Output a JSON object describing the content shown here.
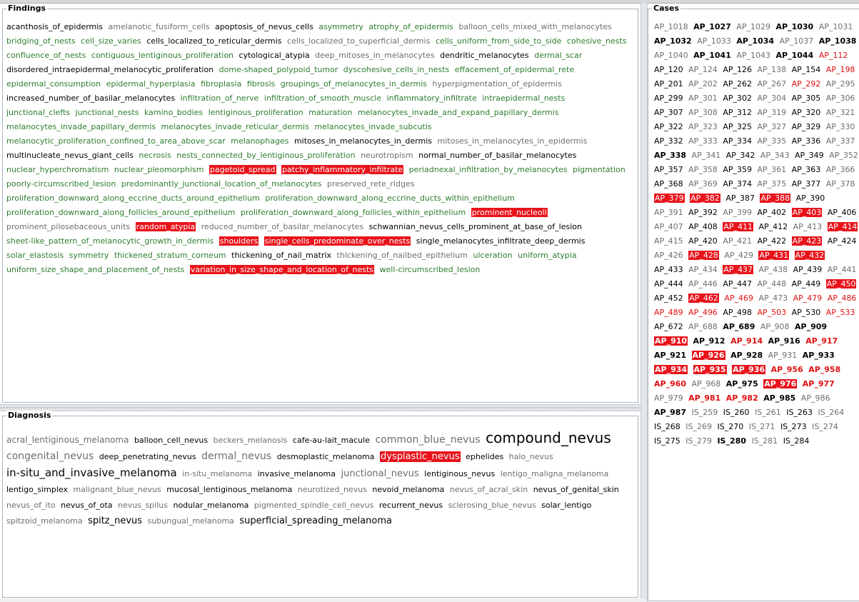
{
  "panels": {
    "findings_title": "Findings",
    "diagnosis_title": "Diagnosis",
    "cases_title": "Cases"
  },
  "colors": {
    "positive": "#2e7d2e",
    "negative": "#000000",
    "inactive": "#6e6e6e",
    "alert": "#e01010",
    "selected_bg": "#e8131b"
  },
  "findings": [
    {
      "t": "acanthosis_of_epidermis",
      "s": "neutral"
    },
    {
      "t": "amelanotic_fusiform_cells",
      "s": "gray"
    },
    {
      "t": "apoptosis_of_nevus_cells",
      "s": "neutral"
    },
    {
      "t": "asymmetry",
      "s": "green"
    },
    {
      "t": "atrophy_of_epidermis",
      "s": "green"
    },
    {
      "t": "balloon_cells_mixed_with_melanocytes",
      "s": "gray"
    },
    {
      "t": "bridging_of_nests",
      "s": "green"
    },
    {
      "t": "cell_size_varies",
      "s": "green"
    },
    {
      "t": "cells_localized_to_reticular_dermis",
      "s": "neutral"
    },
    {
      "t": "cells_localized_to_superficial_dermis",
      "s": "gray"
    },
    {
      "t": "cells_uniform_from_side_to_side",
      "s": "green"
    },
    {
      "t": "cohesive_nests",
      "s": "green"
    },
    {
      "t": "confluence_of_nests",
      "s": "green"
    },
    {
      "t": "contiguous_lentiginous_proliferation",
      "s": "green"
    },
    {
      "t": "cytological_atypia",
      "s": "neutral"
    },
    {
      "t": "deep_mitoses_in_melanocytes",
      "s": "gray"
    },
    {
      "t": "dendritic_melanocytes",
      "s": "neutral"
    },
    {
      "t": "dermal_scar",
      "s": "green"
    },
    {
      "t": "disordered_intraepidermal_melanocytic_proliferation",
      "s": "neutral"
    },
    {
      "t": "dome-shaped_polypoid_tumor",
      "s": "green"
    },
    {
      "t": "dyscohesive_cells_in_nests",
      "s": "green"
    },
    {
      "t": "effacement_of_epidermal_rete",
      "s": "green"
    },
    {
      "t": "epidermal_consumption",
      "s": "green"
    },
    {
      "t": "epidermal_hyperplasia",
      "s": "green"
    },
    {
      "t": "fibroplasia",
      "s": "green"
    },
    {
      "t": "fibrosis",
      "s": "green"
    },
    {
      "t": "groupings_of_melanocytes_in_dermis",
      "s": "green"
    },
    {
      "t": "hyperpigmentation_of_epidermis",
      "s": "gray"
    },
    {
      "t": "increased_number_of_basilar_melanocytes",
      "s": "neutral"
    },
    {
      "t": "infiltration_of_nerve",
      "s": "green"
    },
    {
      "t": "infiltration_of_smooth_muscle",
      "s": "green"
    },
    {
      "t": "inflammatory_infiltrate",
      "s": "green"
    },
    {
      "t": "intraepidermal_nests",
      "s": "green"
    },
    {
      "t": "junctional_clefts",
      "s": "green"
    },
    {
      "t": "junctional_nests",
      "s": "green"
    },
    {
      "t": "kamino_bodies",
      "s": "green"
    },
    {
      "t": "lentiginous_proliferation",
      "s": "green"
    },
    {
      "t": "maturation",
      "s": "green"
    },
    {
      "t": "melanocytes_invade_and_expand_papillary_dermis",
      "s": "green"
    },
    {
      "t": "melanocytes_invade_papillary_dermis",
      "s": "green"
    },
    {
      "t": "melanocytes_invade_reticular_dermis",
      "s": "green"
    },
    {
      "t": "melanocytes_invade_subcutis",
      "s": "green"
    },
    {
      "t": "melanocytic_proliferation_confined_to_area_above_scar",
      "s": "green"
    },
    {
      "t": "melanophages",
      "s": "green"
    },
    {
      "t": "mitoses_in_melanocytes_in_dermis",
      "s": "neutral"
    },
    {
      "t": "mitoses_in_melanocytes_in_epidermis",
      "s": "gray"
    },
    {
      "t": "multinucleate_nevus_giant_cells",
      "s": "neutral"
    },
    {
      "t": "necrosis",
      "s": "green"
    },
    {
      "t": "nests_connected_by_lentiginous_proliferation",
      "s": "green"
    },
    {
      "t": "neurotropism",
      "s": "gray"
    },
    {
      "t": "normal_number_of_basilar_melanocytes",
      "s": "neutral"
    },
    {
      "t": "nuclear_hyperchromatism",
      "s": "green"
    },
    {
      "t": "nuclear_pleomorphism",
      "s": "green"
    },
    {
      "t": "pagetoid_spread",
      "s": "sel"
    },
    {
      "t": "patchy_inflammatory_infiltrate",
      "s": "sel"
    },
    {
      "t": "periadnexal_infiltration_by_melanocytes",
      "s": "green"
    },
    {
      "t": "pigmentation",
      "s": "green"
    },
    {
      "t": "poorly-circumscribed_lesion",
      "s": "green"
    },
    {
      "t": "predominantly_junctional_location_of_melanocytes",
      "s": "green"
    },
    {
      "t": "preserved_rete_ridges",
      "s": "gray"
    },
    {
      "t": "proliferation_downward_along_eccrine_ducts_around_epithelium",
      "s": "green"
    },
    {
      "t": "proliferation_downward_along_eccrine_ducts_within_epithelium",
      "s": "green"
    },
    {
      "t": "proliferation_downward_along_follicles_around_epithelium",
      "s": "green"
    },
    {
      "t": "proliferation_downward_along_follicles_within_epithelium",
      "s": "green"
    },
    {
      "t": "prominent_nucleoli",
      "s": "sel"
    },
    {
      "t": "prominent_pilosebaceous_units",
      "s": "gray"
    },
    {
      "t": "random_atypia",
      "s": "sel"
    },
    {
      "t": "reduced_number_of_basilar_melanocytes",
      "s": "gray"
    },
    {
      "t": "schwannian_nevus_cells_prominent_at_base_of_lesion",
      "s": "neutral"
    },
    {
      "t": "sheet-like_pattern_of_melanocytic_growth_in_dermis",
      "s": "green"
    },
    {
      "t": "shoulders",
      "s": "sel"
    },
    {
      "t": "single_cells_predominate_over_nests",
      "s": "sel"
    },
    {
      "t": "single_melanocytes_infiltrate_deep_dermis",
      "s": "neutral"
    },
    {
      "t": "solar_elastosis",
      "s": "green"
    },
    {
      "t": "symmetry",
      "s": "green"
    },
    {
      "t": "thickened_stratum_corneum",
      "s": "green"
    },
    {
      "t": "thickening_of_nail_matrix",
      "s": "neutral"
    },
    {
      "t": "thickening_of_nailbed_epithelium",
      "s": "gray"
    },
    {
      "t": "ulceration",
      "s": "green"
    },
    {
      "t": "uniform_atypia",
      "s": "green"
    },
    {
      "t": "uniform_size_shape_and_placement_of_nests",
      "s": "green"
    },
    {
      "t": "variation_in_size_shape_and_location_of_nests",
      "s": "sel"
    },
    {
      "t": "well-circumscribed_lesion",
      "s": "green"
    }
  ],
  "diagnosis": [
    {
      "t": "acral_lentiginous_melanoma",
      "s": "gray",
      "z": 12
    },
    {
      "t": "balloon_cell_nevus",
      "s": "neutral",
      "z": 11
    },
    {
      "t": "beckers_melanosis",
      "s": "gray",
      "z": 11
    },
    {
      "t": "cafe-au-lait_macule",
      "s": "neutral",
      "z": 11
    },
    {
      "t": "common_blue_nevus",
      "s": "gray",
      "z": 14
    },
    {
      "t": "compound_nevus",
      "s": "neutral",
      "z": 20
    },
    {
      "t": "congenital_nevus",
      "s": "gray",
      "z": 14
    },
    {
      "t": "deep_penetrating_nevus",
      "s": "neutral",
      "z": 11
    },
    {
      "t": "dermal_nevus",
      "s": "gray",
      "z": 14
    },
    {
      "t": "desmoplastic_melanoma",
      "s": "neutral",
      "z": 11
    },
    {
      "t": "dysplastic_nevus",
      "s": "sel",
      "z": 13
    },
    {
      "t": "ephelides",
      "s": "neutral",
      "z": 11
    },
    {
      "t": "halo_nevus",
      "s": "gray",
      "z": 11
    },
    {
      "t": "in-situ_and_invasive_melanoma",
      "s": "neutral",
      "z": 15
    },
    {
      "t": "in-situ_melanoma",
      "s": "gray",
      "z": 11
    },
    {
      "t": "invasive_melanoma",
      "s": "neutral",
      "z": 11
    },
    {
      "t": "junctional_nevus",
      "s": "gray",
      "z": 13
    },
    {
      "t": "lentiginous_nevus",
      "s": "neutral",
      "z": 11
    },
    {
      "t": "lentigo_maligna_melanoma",
      "s": "gray",
      "z": 11
    },
    {
      "t": "lentigo_simplex",
      "s": "neutral",
      "z": 11
    },
    {
      "t": "malignant_blue_nevus",
      "s": "gray",
      "z": 11
    },
    {
      "t": "mucosal_lentiginous_melanoma",
      "s": "neutral",
      "z": 11
    },
    {
      "t": "neurotized_nevus",
      "s": "gray",
      "z": 11
    },
    {
      "t": "nevoid_melanoma",
      "s": "neutral",
      "z": 11
    },
    {
      "t": "nevus_of_acral_skin",
      "s": "gray",
      "z": 11
    },
    {
      "t": "nevus_of_genital_skin",
      "s": "neutral",
      "z": 11
    },
    {
      "t": "nevus_of_ito",
      "s": "gray",
      "z": 11
    },
    {
      "t": "nevus_of_ota",
      "s": "neutral",
      "z": 11
    },
    {
      "t": "nevus_spilus",
      "s": "gray",
      "z": 11
    },
    {
      "t": "nodular_melanoma",
      "s": "neutral",
      "z": 11
    },
    {
      "t": "pigmented_spindle_cell_nevus",
      "s": "gray",
      "z": 11
    },
    {
      "t": "recurrent_nevus",
      "s": "neutral",
      "z": 11
    },
    {
      "t": "sclerosing_blue_nevus",
      "s": "gray",
      "z": 11
    },
    {
      "t": "solar_lentigo",
      "s": "neutral",
      "z": 11
    },
    {
      "t": "spitzoid_melanoma",
      "s": "gray",
      "z": 11
    },
    {
      "t": "spitz_nevus",
      "s": "neutral",
      "z": 13
    },
    {
      "t": "subungual_melanoma",
      "s": "gray",
      "z": 11
    },
    {
      "t": "superficial_spreading_melanoma",
      "s": "neutral",
      "z": 13
    }
  ],
  "cases": [
    {
      "t": "AP_1018",
      "s": "gray"
    },
    {
      "t": "AP_1027",
      "s": "bold"
    },
    {
      "t": "AP_1029",
      "s": "gray"
    },
    {
      "t": "AP_1030",
      "s": "bold"
    },
    {
      "t": "AP_1031",
      "s": "gray"
    },
    {
      "t": "AP_1032",
      "s": "bold"
    },
    {
      "t": "AP_1033",
      "s": "gray"
    },
    {
      "t": "AP_1034",
      "s": "bold"
    },
    {
      "t": "AP_1037",
      "s": "gray"
    },
    {
      "t": "AP_1038",
      "s": "bold"
    },
    {
      "t": "AP_1040",
      "s": "gray"
    },
    {
      "t": "AP_1041",
      "s": "bold"
    },
    {
      "t": "AP_1043",
      "s": "gray"
    },
    {
      "t": "AP_1044",
      "s": "bold"
    },
    {
      "t": "AP_112",
      "s": "red"
    },
    {
      "t": "AP_120",
      "s": "neutral"
    },
    {
      "t": "AP_124",
      "s": "gray"
    },
    {
      "t": "AP_126",
      "s": "neutral"
    },
    {
      "t": "AP_138",
      "s": "gray"
    },
    {
      "t": "AP_154",
      "s": "neutral"
    },
    {
      "t": "AP_198",
      "s": "red"
    },
    {
      "t": "AP_201",
      "s": "neutral"
    },
    {
      "t": "AP_202",
      "s": "gray"
    },
    {
      "t": "AP_262",
      "s": "neutral"
    },
    {
      "t": "AP_267",
      "s": "gray"
    },
    {
      "t": "AP_292",
      "s": "red"
    },
    {
      "t": "AP_295",
      "s": "gray"
    },
    {
      "t": "AP_299",
      "s": "neutral"
    },
    {
      "t": "AP_301",
      "s": "gray"
    },
    {
      "t": "AP_302",
      "s": "neutral"
    },
    {
      "t": "AP_304",
      "s": "gray"
    },
    {
      "t": "AP_305",
      "s": "neutral"
    },
    {
      "t": "AP_306",
      "s": "gray"
    },
    {
      "t": "AP_307",
      "s": "neutral"
    },
    {
      "t": "AP_308",
      "s": "gray"
    },
    {
      "t": "AP_312",
      "s": "neutral"
    },
    {
      "t": "AP_319",
      "s": "gray"
    },
    {
      "t": "AP_320",
      "s": "neutral"
    },
    {
      "t": "AP_321",
      "s": "gray"
    },
    {
      "t": "AP_322",
      "s": "neutral"
    },
    {
      "t": "AP_323",
      "s": "gray"
    },
    {
      "t": "AP_325",
      "s": "neutral"
    },
    {
      "t": "AP_327",
      "s": "gray"
    },
    {
      "t": "AP_329",
      "s": "neutral"
    },
    {
      "t": "AP_330",
      "s": "gray"
    },
    {
      "t": "AP_332",
      "s": "neutral"
    },
    {
      "t": "AP_333",
      "s": "gray"
    },
    {
      "t": "AP_334",
      "s": "neutral"
    },
    {
      "t": "AP_335",
      "s": "gray"
    },
    {
      "t": "AP_336",
      "s": "neutral"
    },
    {
      "t": "AP_337",
      "s": "gray"
    },
    {
      "t": "AP_338",
      "s": "bold"
    },
    {
      "t": "AP_341",
      "s": "gray"
    },
    {
      "t": "AP_342",
      "s": "neutral"
    },
    {
      "t": "AP_343",
      "s": "gray"
    },
    {
      "t": "AP_349",
      "s": "neutral"
    },
    {
      "t": "AP_352",
      "s": "gray"
    },
    {
      "t": "AP_357",
      "s": "neutral"
    },
    {
      "t": "AP_358",
      "s": "gray"
    },
    {
      "t": "AP_359",
      "s": "neutral"
    },
    {
      "t": "AP_361",
      "s": "gray"
    },
    {
      "t": "AP_363",
      "s": "neutral"
    },
    {
      "t": "AP_366",
      "s": "gray"
    },
    {
      "t": "AP_368",
      "s": "neutral"
    },
    {
      "t": "AP_369",
      "s": "gray"
    },
    {
      "t": "AP_374",
      "s": "neutral"
    },
    {
      "t": "AP_375",
      "s": "gray"
    },
    {
      "t": "AP_377",
      "s": "neutral"
    },
    {
      "t": "AP_378",
      "s": "gray"
    },
    {
      "t": "AP_379",
      "s": "sel"
    },
    {
      "t": "AP_382",
      "s": "sel"
    },
    {
      "t": "AP_387",
      "s": "neutral"
    },
    {
      "t": "AP_388",
      "s": "sel"
    },
    {
      "t": "AP_390",
      "s": "neutral"
    },
    {
      "t": "AP_391",
      "s": "gray"
    },
    {
      "t": "AP_392",
      "s": "neutral"
    },
    {
      "t": "AP_399",
      "s": "gray"
    },
    {
      "t": "AP_402",
      "s": "neutral"
    },
    {
      "t": "AP_403",
      "s": "sel"
    },
    {
      "t": "AP_406",
      "s": "neutral"
    },
    {
      "t": "AP_407",
      "s": "gray"
    },
    {
      "t": "AP_408",
      "s": "neutral"
    },
    {
      "t": "AP_411",
      "s": "sel"
    },
    {
      "t": "AP_412",
      "s": "neutral"
    },
    {
      "t": "AP_413",
      "s": "gray"
    },
    {
      "t": "AP_414",
      "s": "sel"
    },
    {
      "t": "AP_415",
      "s": "gray"
    },
    {
      "t": "AP_420",
      "s": "neutral"
    },
    {
      "t": "AP_421",
      "s": "gray"
    },
    {
      "t": "AP_422",
      "s": "neutral"
    },
    {
      "t": "AP_423",
      "s": "sel"
    },
    {
      "t": "AP_424",
      "s": "neutral"
    },
    {
      "t": "AP_426",
      "s": "gray"
    },
    {
      "t": "AP_428",
      "s": "sel"
    },
    {
      "t": "AP_429",
      "s": "gray"
    },
    {
      "t": "AP_431",
      "s": "sel"
    },
    {
      "t": "AP_432",
      "s": "sel"
    },
    {
      "t": "AP_433",
      "s": "neutral"
    },
    {
      "t": "AP_434",
      "s": "gray"
    },
    {
      "t": "AP_437",
      "s": "sel"
    },
    {
      "t": "AP_438",
      "s": "gray"
    },
    {
      "t": "AP_439",
      "s": "neutral"
    },
    {
      "t": "AP_441",
      "s": "gray"
    },
    {
      "t": "AP_444",
      "s": "neutral"
    },
    {
      "t": "AP_446",
      "s": "gray"
    },
    {
      "t": "AP_447",
      "s": "neutral"
    },
    {
      "t": "AP_448",
      "s": "gray"
    },
    {
      "t": "AP_449",
      "s": "neutral"
    },
    {
      "t": "AP_450",
      "s": "sel"
    },
    {
      "t": "AP_452",
      "s": "neutral"
    },
    {
      "t": "AP_462",
      "s": "sel"
    },
    {
      "t": "AP_469",
      "s": "red"
    },
    {
      "t": "AP_473",
      "s": "gray"
    },
    {
      "t": "AP_479",
      "s": "red"
    },
    {
      "t": "AP_486",
      "s": "red"
    },
    {
      "t": "AP_489",
      "s": "red"
    },
    {
      "t": "AP_496",
      "s": "red"
    },
    {
      "t": "AP_498",
      "s": "neutral"
    },
    {
      "t": "AP_503",
      "s": "red"
    },
    {
      "t": "AP_530",
      "s": "neutral"
    },
    {
      "t": "AP_533",
      "s": "red"
    },
    {
      "t": "AP_672",
      "s": "neutral"
    },
    {
      "t": "AP_688",
      "s": "gray"
    },
    {
      "t": "AP_689",
      "s": "bold"
    },
    {
      "t": "AP_908",
      "s": "gray"
    },
    {
      "t": "AP_909",
      "s": "bold"
    },
    {
      "t": "AP_910",
      "s": "selbold"
    },
    {
      "t": "AP_912",
      "s": "bold"
    },
    {
      "t": "AP_914",
      "s": "redbold"
    },
    {
      "t": "AP_916",
      "s": "bold"
    },
    {
      "t": "AP_917",
      "s": "redbold"
    },
    {
      "t": "AP_921",
      "s": "bold"
    },
    {
      "t": "AP_926",
      "s": "selbold"
    },
    {
      "t": "AP_928",
      "s": "bold"
    },
    {
      "t": "AP_931",
      "s": "gray"
    },
    {
      "t": "AP_933",
      "s": "bold"
    },
    {
      "t": "AP_934",
      "s": "selbold"
    },
    {
      "t": "AP_935",
      "s": "selbold"
    },
    {
      "t": "AP_936",
      "s": "selbold"
    },
    {
      "t": "AP_956",
      "s": "redbold"
    },
    {
      "t": "AP_958",
      "s": "redbold"
    },
    {
      "t": "AP_960",
      "s": "redbold"
    },
    {
      "t": "AP_968",
      "s": "gray"
    },
    {
      "t": "AP_975",
      "s": "bold"
    },
    {
      "t": "AP_976",
      "s": "selbold"
    },
    {
      "t": "AP_977",
      "s": "redbold"
    },
    {
      "t": "AP_979",
      "s": "gray"
    },
    {
      "t": "AP_981",
      "s": "redbold"
    },
    {
      "t": "AP_982",
      "s": "redbold"
    },
    {
      "t": "AP_985",
      "s": "bold"
    },
    {
      "t": "AP_986",
      "s": "gray"
    },
    {
      "t": "AP_987",
      "s": "bold"
    },
    {
      "t": "IS_259",
      "s": "gray"
    },
    {
      "t": "IS_260",
      "s": "neutral"
    },
    {
      "t": "IS_261",
      "s": "gray"
    },
    {
      "t": "IS_263",
      "s": "neutral"
    },
    {
      "t": "IS_264",
      "s": "gray"
    },
    {
      "t": "IS_268",
      "s": "neutral"
    },
    {
      "t": "IS_269",
      "s": "gray"
    },
    {
      "t": "IS_270",
      "s": "neutral"
    },
    {
      "t": "IS_271",
      "s": "gray"
    },
    {
      "t": "IS_273",
      "s": "neutral"
    },
    {
      "t": "IS_274",
      "s": "gray"
    },
    {
      "t": "IS_275",
      "s": "neutral"
    },
    {
      "t": "IS_279",
      "s": "gray"
    },
    {
      "t": "IS_280",
      "s": "bold"
    },
    {
      "t": "IS_281",
      "s": "gray"
    },
    {
      "t": "IS_284",
      "s": "neutral"
    }
  ]
}
